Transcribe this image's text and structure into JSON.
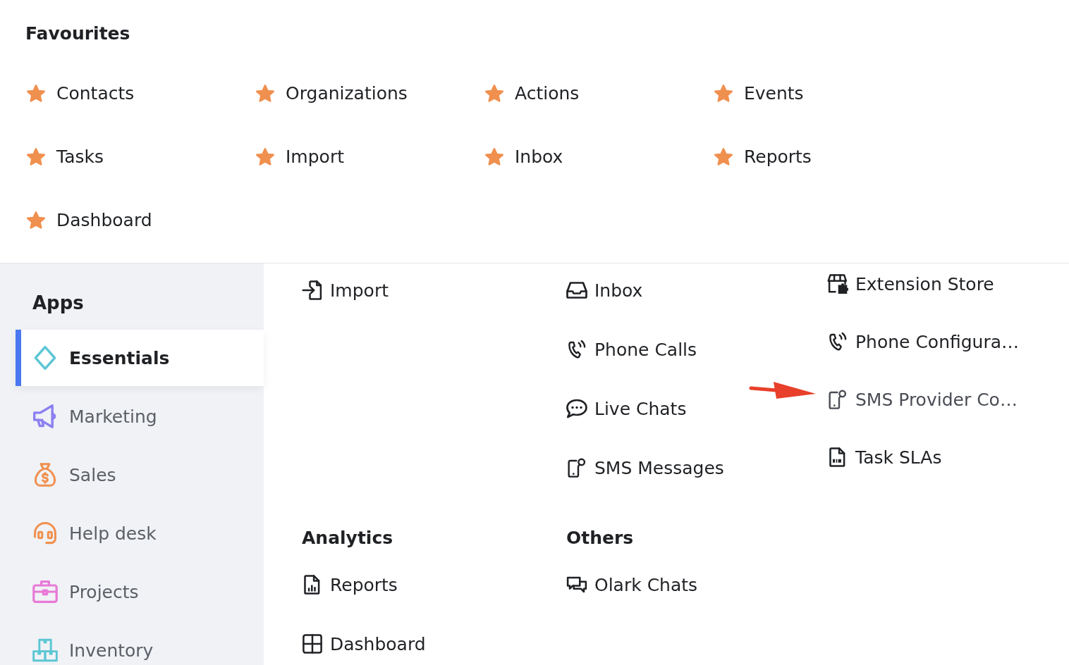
{
  "favourites": {
    "title": "Favourites",
    "items": [
      "Contacts",
      "Organizations",
      "Actions",
      "Events",
      "Tasks",
      "Import",
      "Inbox",
      "Reports",
      "Dashboard"
    ]
  },
  "apps": {
    "title": "Apps",
    "items": [
      {
        "label": "Essentials",
        "selected": true
      },
      {
        "label": "Marketing",
        "selected": false
      },
      {
        "label": "Sales",
        "selected": false
      },
      {
        "label": "Help desk",
        "selected": false
      },
      {
        "label": "Projects",
        "selected": false
      },
      {
        "label": "Inventory",
        "selected": false
      }
    ]
  },
  "essentials": {
    "columns": [
      {
        "items": [
          {
            "label": "Import",
            "highlighted": false
          }
        ]
      },
      {
        "items": [
          {
            "label": "Inbox",
            "highlighted": false
          },
          {
            "label": "Phone Calls",
            "highlighted": false
          },
          {
            "label": "Live Chats",
            "highlighted": false
          },
          {
            "label": "SMS Messages",
            "highlighted": false
          }
        ]
      },
      {
        "items": [
          {
            "label": "Extension Store",
            "highlighted": false
          },
          {
            "label": "Phone Configura…",
            "highlighted": false
          },
          {
            "label": "SMS Provider Co…",
            "highlighted": true
          },
          {
            "label": "Task SLAs",
            "highlighted": false
          }
        ]
      }
    ]
  },
  "sections": [
    {
      "title": "Analytics",
      "items": [
        "Reports",
        "Dashboard"
      ]
    },
    {
      "title": "Others",
      "items": [
        "Olark Chats"
      ]
    }
  ]
}
